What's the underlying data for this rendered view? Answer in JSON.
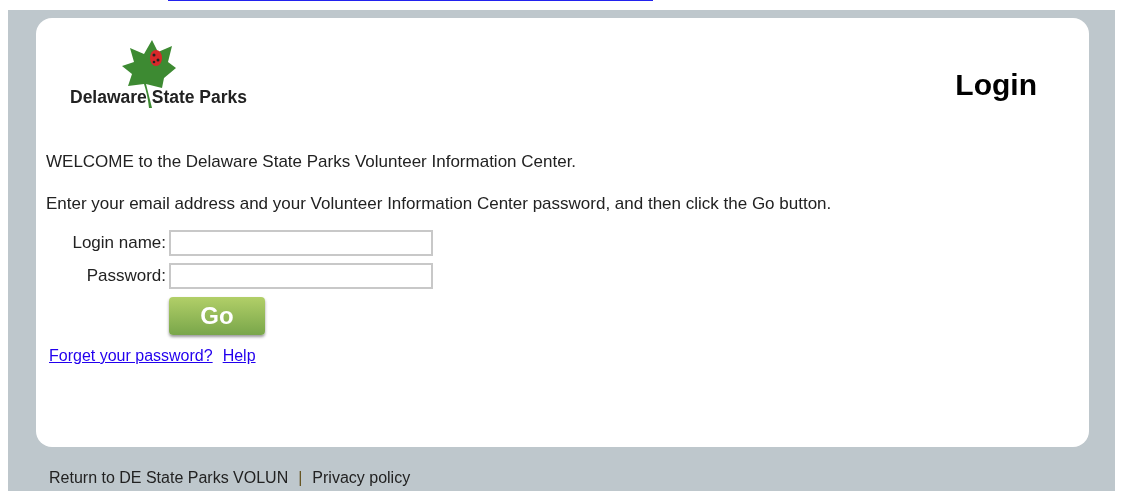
{
  "logo": {
    "text": "Delaware State Parks"
  },
  "page_title": "Login",
  "intro": [
    "WELCOME to the Delaware State Parks Volunteer Information Center.",
    "Enter your email address and your Volunteer Information Center password, and then click the Go button."
  ],
  "form": {
    "fields": [
      {
        "label": "Login name:"
      },
      {
        "label": "Password:"
      }
    ],
    "submit": "Go"
  },
  "links": [
    "Forget your password?",
    "Help"
  ],
  "footer": {
    "links": [
      "Return to DE State Parks VOLUN",
      "Privacy policy"
    ],
    "separator": "|"
  }
}
